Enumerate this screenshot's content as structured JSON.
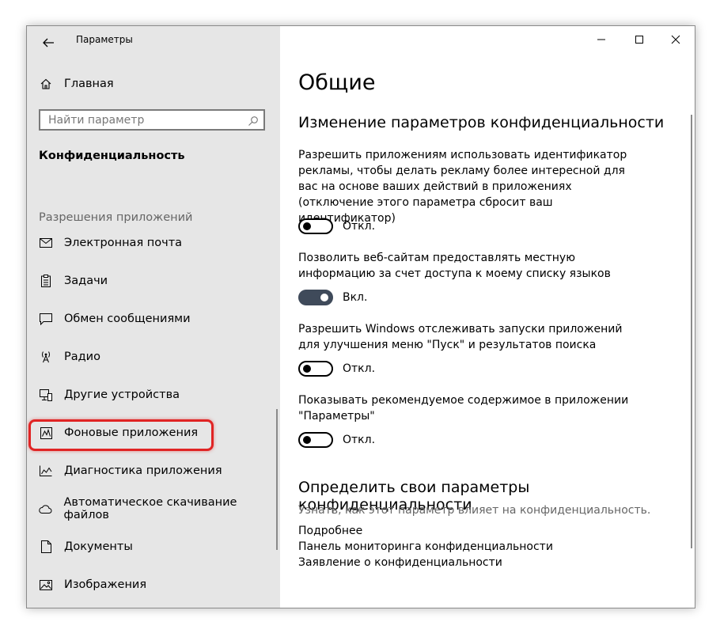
{
  "window": {
    "app_title": "Параметры"
  },
  "sidebar": {
    "home_label": "Главная",
    "search_placeholder": "Найти параметр",
    "section_title": "Конфиденциальность",
    "group_label": "Разрешения приложений",
    "items": [
      {
        "label": "Электронная почта",
        "icon": "mail-icon"
      },
      {
        "label": "Задачи",
        "icon": "tasks-icon"
      },
      {
        "label": "Обмен сообщениями",
        "icon": "chat-icon"
      },
      {
        "label": "Радио",
        "icon": "radio-icon"
      },
      {
        "label": "Другие устройства",
        "icon": "devices-icon"
      },
      {
        "label": "Фоновые приложения",
        "icon": "background-apps-icon"
      },
      {
        "label": "Диагностика приложения",
        "icon": "diagnostics-icon"
      },
      {
        "label": "Автоматическое скачивание файлов",
        "icon": "cloud-icon"
      },
      {
        "label": "Документы",
        "icon": "document-icon"
      },
      {
        "label": "Изображения",
        "icon": "image-icon"
      }
    ],
    "highlight_color": "#e02424"
  },
  "content": {
    "page_title": "Общие",
    "section1_title": "Изменение параметров конфиденциальности",
    "settings": [
      {
        "description": "Разрешить приложениям использовать идентификатор рекламы, чтобы делать рекламу более интересной для вас на основе ваших действий в приложениях (отключение этого параметра сбросит ваш идентификатор)",
        "state": "Откл.",
        "on": false
      },
      {
        "description": "Позволить веб-сайтам предоставлять местную информацию за счет доступа к моему списку языков",
        "state": "Вкл.",
        "on": true
      },
      {
        "description": "Разрешить Windows отслеживать запуски приложений для улучшения меню \"Пуск\" и результатов поиска",
        "state": "Откл.",
        "on": false
      },
      {
        "description": "Показывать рекомендуемое содержимое в приложении \"Параметры\"",
        "state": "Откл.",
        "on": false
      }
    ],
    "section2_title": "Определить свои параметры конфиденциальности",
    "section2_hint": "Узнать, как этот параметр влияет на конфиденциальность.",
    "links": [
      "Подробнее",
      "Панель мониторинга конфиденциальности",
      "Заявление о конфиденциальности"
    ],
    "toggle_on_color": "#3f4a5a"
  }
}
